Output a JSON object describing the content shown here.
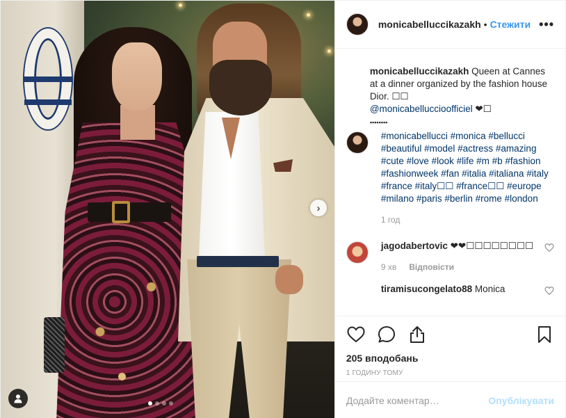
{
  "post": {
    "author": "monicabelluccikazakh",
    "follow_label": "Стежити",
    "separator": "•",
    "more_label": "•••"
  },
  "caption": {
    "author": "monicabelluccikazakh",
    "text": "Queen at Cannes at a dinner organized by the fashion house Dior. ",
    "emoji1": "☐☐",
    "mention": "@monicabelluccioofficiel",
    "emoji2": "❤☐",
    "dots": "▪▪▪▪▪▪▪▪",
    "hashtags": "#monicabellucci #monica #bellucci #beautiful #model #actress #amazing #cute #love #look #life #m #b #fashion #fashionweek #fan #italia #italiana #italy #france #italy☐☐ #france☐☐ #europe #milano #paris #berlin #rome #london",
    "time": "1 год"
  },
  "comments": [
    {
      "author": "jagodabertovic",
      "text": "❤❤☐☐☐☐☐☐☐☐",
      "time": "9 хв",
      "reply_label": "Відповісти"
    },
    {
      "author": "tiramisucongelato88",
      "text": "Monica"
    }
  ],
  "likes": "205 вподобань",
  "posted": "1 ГОДИНУ ТОМУ",
  "add_comment": {
    "placeholder": "Додайте коментар…",
    "publish_label": "Опублікувати"
  },
  "carousel": {
    "slides": 4,
    "active": 0
  },
  "colors": {
    "link": "#3897f0",
    "publish_disabled": "#b2dffc",
    "muted": "#999999"
  },
  "icons": [
    "next-arrow-icon",
    "tag-user-icon",
    "heart-icon",
    "comment-icon",
    "share-icon",
    "bookmark-icon",
    "more-options-icon"
  ]
}
